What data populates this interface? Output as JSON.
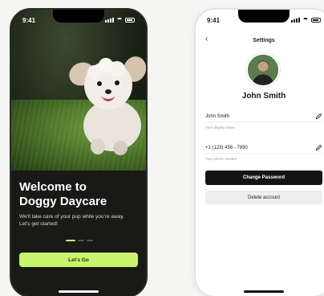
{
  "onboarding": {
    "status_time": "9:41",
    "title": "Welcome to Doggy Daycare",
    "subtitle": "We'll take care of your pup while you're away. Let's get started!",
    "cta_label": "Let's Go",
    "pager": {
      "pages": 3,
      "active_index": 0
    },
    "accent_color": "#c9f46c"
  },
  "settings": {
    "status_time": "9:41",
    "title": "Settings",
    "profile_name": "John Smith",
    "fields": [
      {
        "value": "John Smith",
        "hint": "Your display name",
        "icon": "pencil-icon"
      },
      {
        "value": "+1 (123) 456 - 7890",
        "hint": "Your phone number",
        "icon": "pencil-icon"
      }
    ],
    "change_password_label": "Change Password",
    "delete_account_label": "Delete account"
  }
}
